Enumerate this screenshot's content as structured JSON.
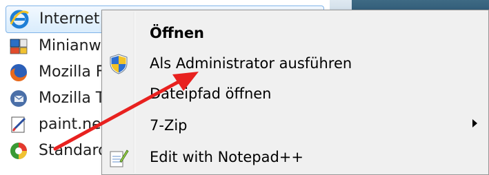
{
  "program_list": {
    "items": [
      {
        "label": "Internet Explorer",
        "icon": "internet-explorer-icon",
        "selected": true
      },
      {
        "label": "Minianwendungen",
        "icon": "gadgets-icon"
      },
      {
        "label": "Mozilla Firefox",
        "icon": "firefox-icon"
      },
      {
        "label": "Mozilla Thunderbird",
        "icon": "thunderbird-icon"
      },
      {
        "label": "paint.net",
        "icon": "paintnet-icon"
      },
      {
        "label": "Standardprogramme",
        "icon": "default-programs-icon"
      }
    ]
  },
  "context_menu": {
    "items": [
      {
        "label": "Öffnen",
        "bold": true
      },
      {
        "label": "Als Administrator ausführen",
        "icon": "uac-shield-icon"
      },
      {
        "label": "Dateipfad öffnen"
      },
      {
        "label": "7-Zip",
        "has_submenu": true
      },
      {
        "label": "Edit with Notepad++",
        "icon": "notepadpp-icon"
      }
    ]
  },
  "colors": {
    "annotation": "#e8211f",
    "selection_border": "#7fb3e8",
    "menu_background": "#f0f0f0"
  }
}
